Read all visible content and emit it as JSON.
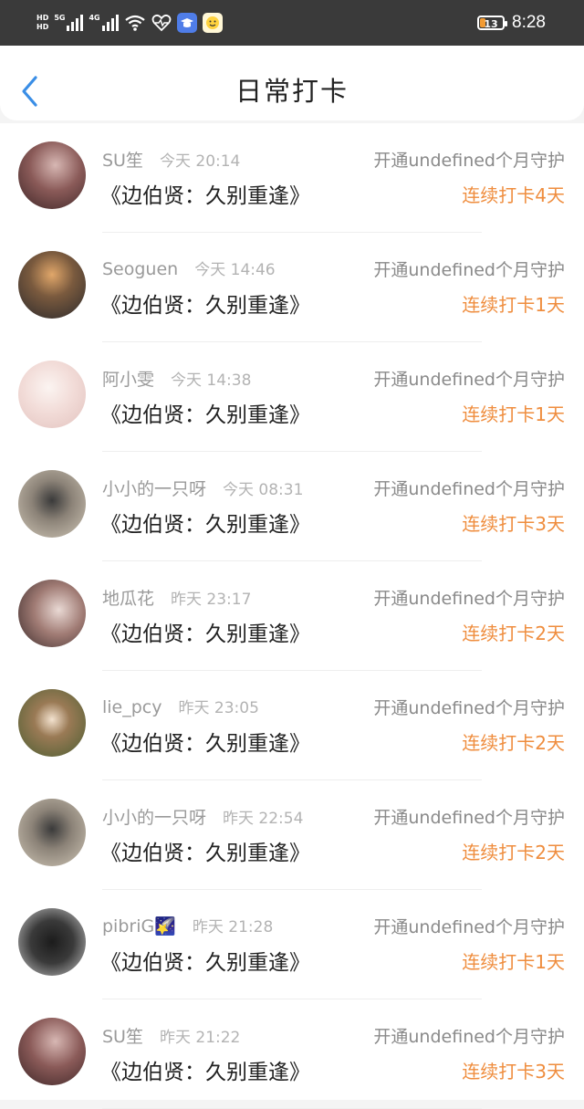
{
  "status_bar": {
    "hd1": "HD",
    "hd2": "HD",
    "net1": "5G",
    "net2": "4G",
    "battery": "13",
    "time": "8:28",
    "icons": [
      "wifi-icon",
      "heart-monitor-icon",
      "graduation-cap-app-icon",
      "smiley-app-icon"
    ]
  },
  "header": {
    "title": "日常打卡",
    "back_icon": "chevron-left-icon"
  },
  "colors": {
    "accent": "#ef8d3e",
    "back_arrow": "#3a8ee6",
    "status_bar": "#3a3a3a"
  },
  "checkins": [
    {
      "user": "SU笙",
      "time": "今天 20:14",
      "book": "《边伯贤：久别重逢》",
      "guard": "开通undefined个月守护",
      "streak": "连续打卡4天"
    },
    {
      "user": "Seoguen",
      "time": "今天 14:46",
      "book": "《边伯贤：久别重逢》",
      "guard": "开通undefined个月守护",
      "streak": "连续打卡1天"
    },
    {
      "user": "阿小雯",
      "time": "今天 14:38",
      "book": "《边伯贤：久别重逢》",
      "guard": "开通undefined个月守护",
      "streak": "连续打卡1天"
    },
    {
      "user": "小小的一只呀",
      "time": "今天 08:31",
      "book": "《边伯贤：久别重逢》",
      "guard": "开通undefined个月守护",
      "streak": "连续打卡3天"
    },
    {
      "user": "地瓜花",
      "time": "昨天 23:17",
      "book": "《边伯贤：久别重逢》",
      "guard": "开通undefined个月守护",
      "streak": "连续打卡2天"
    },
    {
      "user": "lie_pcy",
      "time": "昨天 23:05",
      "book": "《边伯贤：久别重逢》",
      "guard": "开通undefined个月守护",
      "streak": "连续打卡2天"
    },
    {
      "user": "小小的一只呀",
      "time": "昨天 22:54",
      "book": "《边伯贤：久别重逢》",
      "guard": "开通undefined个月守护",
      "streak": "连续打卡2天"
    },
    {
      "user": "pibriG🌠",
      "time": "昨天 21:28",
      "book": "《边伯贤：久别重逢》",
      "guard": "开通undefined个月守护",
      "streak": "连续打卡1天"
    },
    {
      "user": "SU笙",
      "time": "昨天 21:22",
      "book": "《边伯贤：久别重逢》",
      "guard": "开通undefined个月守护",
      "streak": "连续打卡3天"
    }
  ]
}
